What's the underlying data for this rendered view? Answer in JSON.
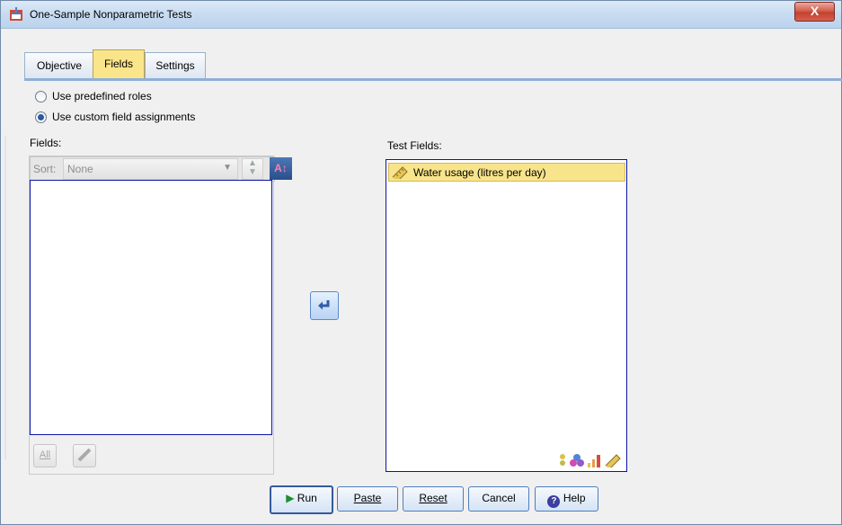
{
  "window": {
    "title": "One-Sample Nonparametric Tests",
    "close_label": "X"
  },
  "tabs": [
    {
      "label": "Objective",
      "active": false
    },
    {
      "label": "Fields",
      "active": true
    },
    {
      "label": "Settings",
      "active": false
    }
  ],
  "roles": {
    "predefined_label": "Use predefined roles",
    "custom_label": "Use custom field assignments",
    "selected": "custom"
  },
  "fields_panel": {
    "label": "Fields:",
    "sort_label": "Sort:",
    "sort_value": "None",
    "all_button": "All",
    "items": []
  },
  "test_fields_panel": {
    "label": "Test Fields:",
    "items": [
      "Water usage (litres per day)"
    ]
  },
  "buttons": {
    "run": "Run",
    "paste": "Paste",
    "reset": "Reset",
    "cancel": "Cancel",
    "help": "Help"
  },
  "colors": {
    "accent": "#8fb0d6",
    "selected_item": "#f8e48b",
    "active_tab": "#fbe58a",
    "list_border": "#0b15a8"
  }
}
